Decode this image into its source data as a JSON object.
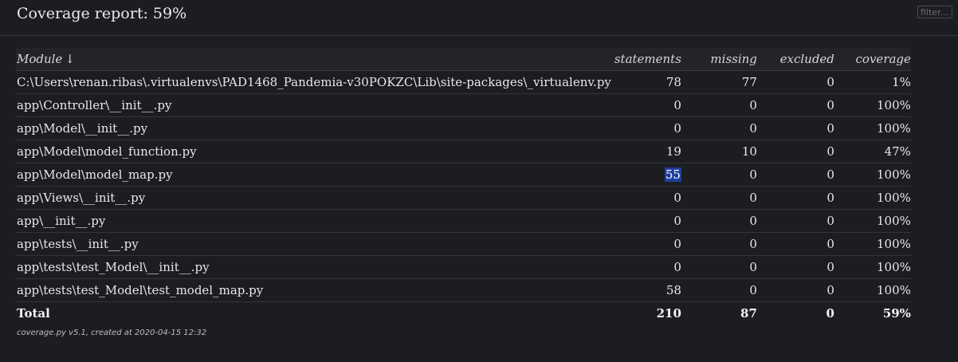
{
  "header": {
    "title": "Coverage report: 59%",
    "filter_placeholder": "filter..."
  },
  "table": {
    "columns": {
      "module": "Module",
      "sort_arrow": "↓",
      "statements": "statements",
      "missing": "missing",
      "excluded": "excluded",
      "coverage": "coverage"
    },
    "rows": [
      {
        "name": "C:\\Users\\renan.ribas\\.virtualenvs\\PAD1468_Pandemia-v30POKZC\\Lib\\site-packages\\_virtualenv.py",
        "statements": "78",
        "missing": "77",
        "excluded": "0",
        "coverage": "1%"
      },
      {
        "name": "app\\Controller\\__init__.py",
        "statements": "0",
        "missing": "0",
        "excluded": "0",
        "coverage": "100%"
      },
      {
        "name": "app\\Model\\__init__.py",
        "statements": "0",
        "missing": "0",
        "excluded": "0",
        "coverage": "100%"
      },
      {
        "name": "app\\Model\\model_function.py",
        "statements": "19",
        "missing": "10",
        "excluded": "0",
        "coverage": "47%"
      },
      {
        "name": "app\\Model\\model_map.py",
        "statements": "55",
        "missing": "0",
        "excluded": "0",
        "coverage": "100%"
      },
      {
        "name": "app\\Views\\__init__.py",
        "statements": "0",
        "missing": "0",
        "excluded": "0",
        "coverage": "100%"
      },
      {
        "name": "app\\__init__.py",
        "statements": "0",
        "missing": "0",
        "excluded": "0",
        "coverage": "100%"
      },
      {
        "name": "app\\tests\\__init__.py",
        "statements": "0",
        "missing": "0",
        "excluded": "0",
        "coverage": "100%"
      },
      {
        "name": "app\\tests\\test_Model\\__init__.py",
        "statements": "0",
        "missing": "0",
        "excluded": "0",
        "coverage": "100%"
      },
      {
        "name": "app\\tests\\test_Model\\test_model_map.py",
        "statements": "58",
        "missing": "0",
        "excluded": "0",
        "coverage": "100%"
      }
    ],
    "total": {
      "name": "Total",
      "statements": "210",
      "missing": "87",
      "excluded": "0",
      "coverage": "59%"
    }
  },
  "footer": {
    "text": "coverage.py v5.1, created at 2020-04-15 12:32"
  },
  "colors": {
    "background": "#1c1d20",
    "selection": "#1f3fa0"
  }
}
